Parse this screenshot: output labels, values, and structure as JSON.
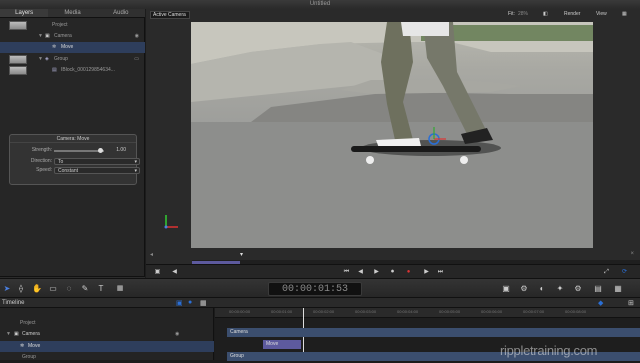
{
  "window": {
    "title": "Untitled"
  },
  "left_panel": {
    "tabs": [
      "Layers",
      "Media",
      "Audio"
    ],
    "layers": [
      {
        "label": "Project",
        "type": "project"
      },
      {
        "label": "Camera",
        "type": "camera"
      },
      {
        "label": "Move",
        "type": "behavior",
        "selected": true
      },
      {
        "label": "Group",
        "type": "group"
      },
      {
        "label": "IBlock_000129854634...",
        "type": "clip"
      }
    ]
  },
  "hud": {
    "title": "Camera: Move",
    "strength_label": "Strength:",
    "strength_value": "1.00",
    "direction_label": "Direction:",
    "direction_value": "To",
    "speed_label": "Speed:",
    "speed_value": "Constant"
  },
  "canvas": {
    "camera_menu": "Active Camera",
    "fit_label": "Fit:",
    "fit_value": "28%",
    "render_label": "Render",
    "view_label": "View"
  },
  "toolbar": {
    "timecode": "00:00:01:53"
  },
  "timeline": {
    "title": "Timeline",
    "ruler_ticks": [
      "00:00:00:00",
      "00:00:01:00",
      "00:00:02:00",
      "00:00:03:00",
      "00:00:04:00",
      "00:00:05:00",
      "00:00:06:00",
      "00:00:07:00",
      "00:00:08:00"
    ],
    "rows": [
      {
        "label": "Project"
      },
      {
        "label": "Camera"
      },
      {
        "label": "Move",
        "selected": true
      },
      {
        "label": "Group"
      }
    ],
    "tracks": {
      "camera": "Camera",
      "move": "Move",
      "group": "Group"
    }
  },
  "watermark": "rippletraining.com",
  "colors": {
    "selection": "#2e3e5c",
    "accent_blue": "#2a6fd6",
    "move_bar": "#5d5a9e"
  }
}
